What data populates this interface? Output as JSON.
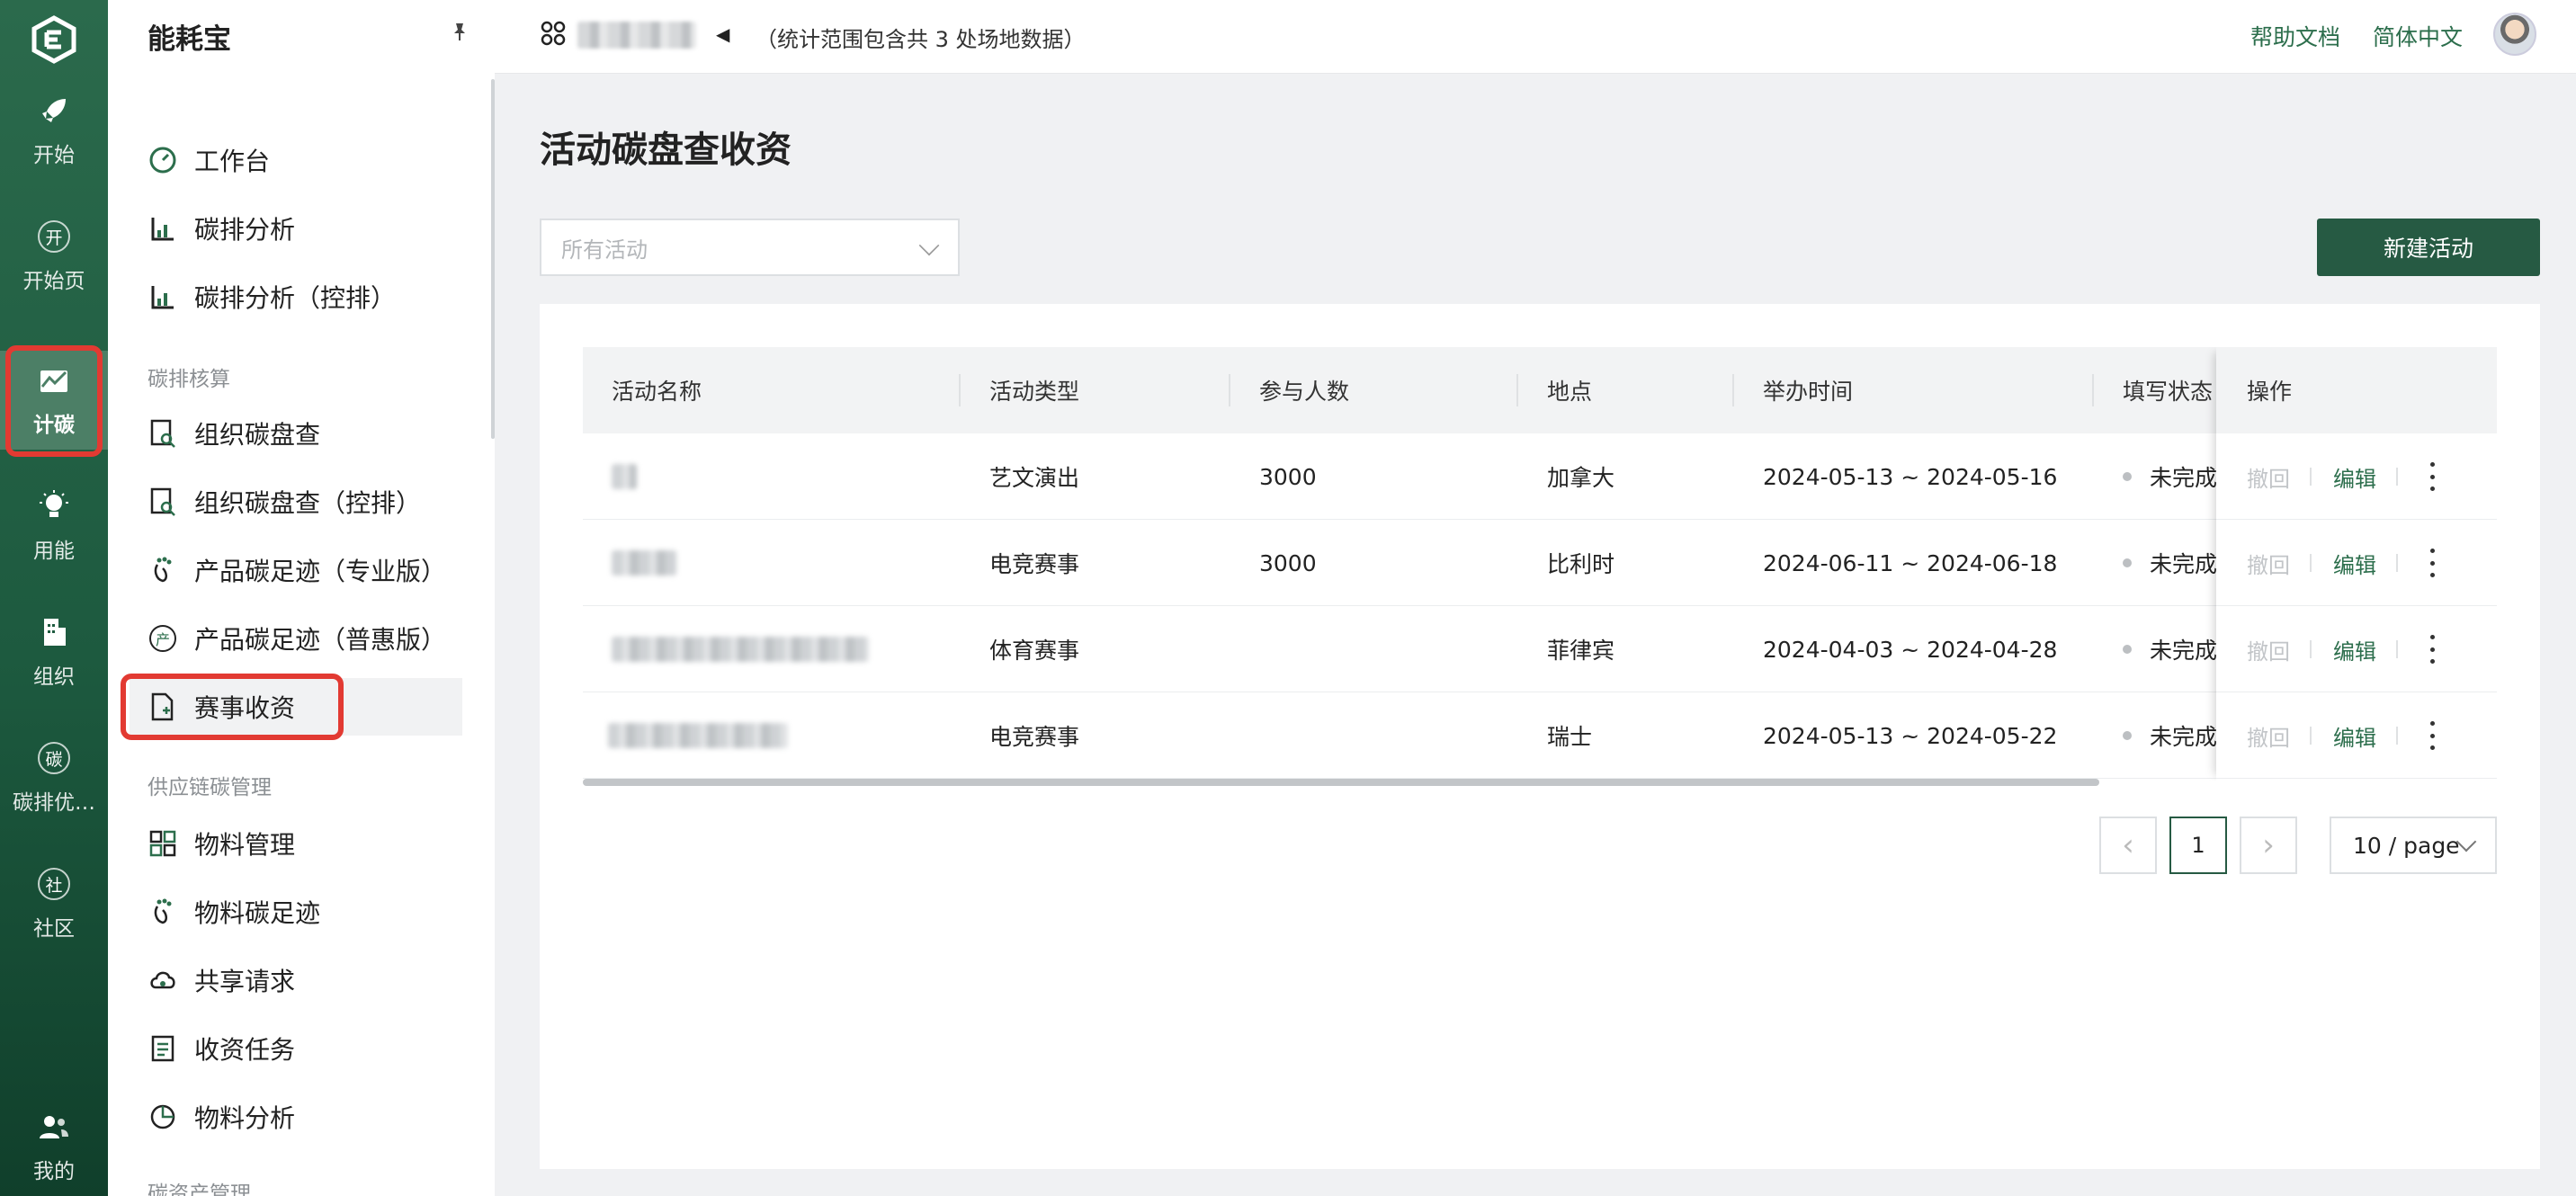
{
  "rail": {
    "items": [
      {
        "label": "开始",
        "icon": "rocket-icon"
      },
      {
        "label": "开始页",
        "icon": "start-page-icon",
        "glyph": "开"
      },
      {
        "label": "计碳",
        "icon": "carbon-accounting-icon"
      },
      {
        "label": "用能",
        "icon": "lightbulb-icon"
      },
      {
        "label": "组织",
        "icon": "building-icon"
      },
      {
        "label": "碳排优…",
        "icon": "carbon-optimize-icon",
        "glyph": "碳"
      },
      {
        "label": "社区",
        "icon": "community-icon",
        "glyph": "社"
      },
      {
        "label": "我的",
        "icon": "user-group-icon"
      }
    ]
  },
  "menu": {
    "brand": "能耗宝",
    "top_items": [
      {
        "label": "工作台",
        "icon": "dashboard-icon"
      },
      {
        "label": "碳排分析",
        "icon": "bar-chart-icon"
      },
      {
        "label": "碳排分析（控排）",
        "icon": "bar-chart-icon"
      }
    ],
    "section_accounting": "碳排核算",
    "accounting_items": [
      {
        "label": "组织碳盘查",
        "icon": "document-search-icon"
      },
      {
        "label": "组织碳盘查（控排）",
        "icon": "document-search-icon"
      },
      {
        "label": "产品碳足迹（专业版）",
        "icon": "footprint-icon"
      },
      {
        "label": "产品碳足迹（普惠版）",
        "icon": "product-badge-icon",
        "glyph": "产"
      },
      {
        "label": "赛事收资",
        "icon": "file-add-icon"
      }
    ],
    "section_supply": "供应链碳管理",
    "supply_items": [
      {
        "label": "物料管理",
        "icon": "material-icon"
      },
      {
        "label": "物料碳足迹",
        "icon": "footprint-icon"
      },
      {
        "label": "共享请求",
        "icon": "cloud-share-icon"
      },
      {
        "label": "收资任务",
        "icon": "task-list-icon"
      },
      {
        "label": "物料分析",
        "icon": "pie-chart-icon"
      }
    ],
    "section_assets": "碳资产管理"
  },
  "topbar": {
    "scope_text": "（统计范围包含共 3 处场地数据）",
    "help": "帮助文档",
    "language": "简体中文"
  },
  "page": {
    "title": "活动碳盘查收资",
    "filter_placeholder": "所有活动",
    "new_button": "新建活动"
  },
  "table": {
    "columns": [
      "活动名称",
      "活动类型",
      "参与人数",
      "地点",
      "举办时间",
      "填写状态",
      "操作"
    ],
    "rows": [
      {
        "type": "艺文演出",
        "participants": "3000",
        "location": "加拿大",
        "time": "2024-05-13 ~ 2024-05-16",
        "status": "未完成"
      },
      {
        "type": "电竞赛事",
        "participants": "3000",
        "location": "比利时",
        "time": "2024-06-11 ~ 2024-06-18",
        "status": "未完成"
      },
      {
        "type": "体育赛事",
        "participants": "",
        "location": "菲律宾",
        "time": "2024-04-03 ~ 2024-04-28",
        "status": "未完成"
      },
      {
        "type": "电竞赛事",
        "participants": "",
        "location": "瑞士",
        "time": "2024-05-13 ~ 2024-05-22",
        "status": "未完成"
      }
    ],
    "actions": {
      "revoke": "撤回",
      "edit": "编辑"
    }
  },
  "pagination": {
    "current": "1",
    "page_size": "10 / page",
    "prev": "‹",
    "next": "›"
  },
  "colors": {
    "brand": "#265a43",
    "link": "#2c6e4c",
    "highlight": "#e23a32"
  }
}
